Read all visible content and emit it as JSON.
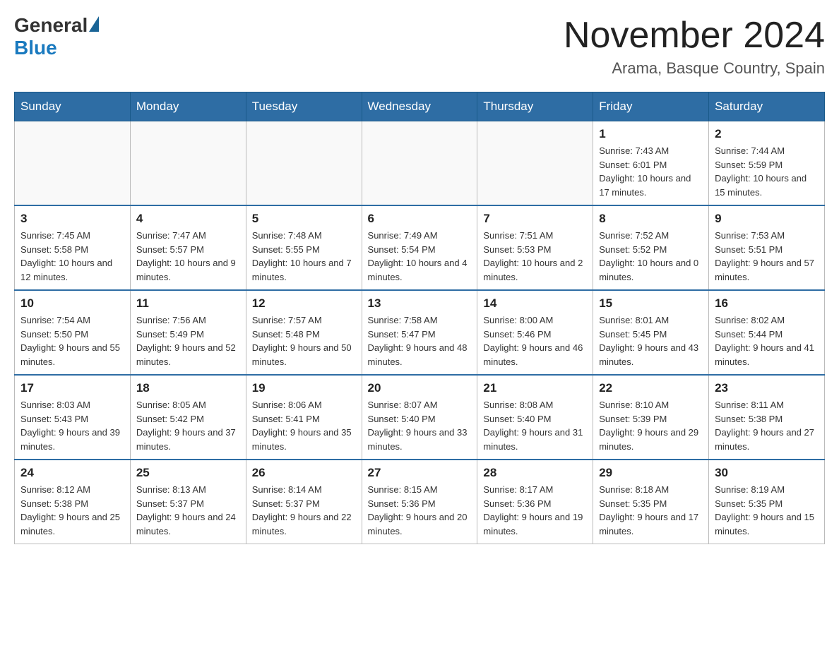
{
  "header": {
    "logo_general": "General",
    "logo_blue": "Blue",
    "month_title": "November 2024",
    "location": "Arama, Basque Country, Spain"
  },
  "days_of_week": [
    "Sunday",
    "Monday",
    "Tuesday",
    "Wednesday",
    "Thursday",
    "Friday",
    "Saturday"
  ],
  "weeks": [
    [
      {
        "day": "",
        "sunrise": "",
        "sunset": "",
        "daylight": ""
      },
      {
        "day": "",
        "sunrise": "",
        "sunset": "",
        "daylight": ""
      },
      {
        "day": "",
        "sunrise": "",
        "sunset": "",
        "daylight": ""
      },
      {
        "day": "",
        "sunrise": "",
        "sunset": "",
        "daylight": ""
      },
      {
        "day": "",
        "sunrise": "",
        "sunset": "",
        "daylight": ""
      },
      {
        "day": "1",
        "sunrise": "Sunrise: 7:43 AM",
        "sunset": "Sunset: 6:01 PM",
        "daylight": "Daylight: 10 hours and 17 minutes."
      },
      {
        "day": "2",
        "sunrise": "Sunrise: 7:44 AM",
        "sunset": "Sunset: 5:59 PM",
        "daylight": "Daylight: 10 hours and 15 minutes."
      }
    ],
    [
      {
        "day": "3",
        "sunrise": "Sunrise: 7:45 AM",
        "sunset": "Sunset: 5:58 PM",
        "daylight": "Daylight: 10 hours and 12 minutes."
      },
      {
        "day": "4",
        "sunrise": "Sunrise: 7:47 AM",
        "sunset": "Sunset: 5:57 PM",
        "daylight": "Daylight: 10 hours and 9 minutes."
      },
      {
        "day": "5",
        "sunrise": "Sunrise: 7:48 AM",
        "sunset": "Sunset: 5:55 PM",
        "daylight": "Daylight: 10 hours and 7 minutes."
      },
      {
        "day": "6",
        "sunrise": "Sunrise: 7:49 AM",
        "sunset": "Sunset: 5:54 PM",
        "daylight": "Daylight: 10 hours and 4 minutes."
      },
      {
        "day": "7",
        "sunrise": "Sunrise: 7:51 AM",
        "sunset": "Sunset: 5:53 PM",
        "daylight": "Daylight: 10 hours and 2 minutes."
      },
      {
        "day": "8",
        "sunrise": "Sunrise: 7:52 AM",
        "sunset": "Sunset: 5:52 PM",
        "daylight": "Daylight: 10 hours and 0 minutes."
      },
      {
        "day": "9",
        "sunrise": "Sunrise: 7:53 AM",
        "sunset": "Sunset: 5:51 PM",
        "daylight": "Daylight: 9 hours and 57 minutes."
      }
    ],
    [
      {
        "day": "10",
        "sunrise": "Sunrise: 7:54 AM",
        "sunset": "Sunset: 5:50 PM",
        "daylight": "Daylight: 9 hours and 55 minutes."
      },
      {
        "day": "11",
        "sunrise": "Sunrise: 7:56 AM",
        "sunset": "Sunset: 5:49 PM",
        "daylight": "Daylight: 9 hours and 52 minutes."
      },
      {
        "day": "12",
        "sunrise": "Sunrise: 7:57 AM",
        "sunset": "Sunset: 5:48 PM",
        "daylight": "Daylight: 9 hours and 50 minutes."
      },
      {
        "day": "13",
        "sunrise": "Sunrise: 7:58 AM",
        "sunset": "Sunset: 5:47 PM",
        "daylight": "Daylight: 9 hours and 48 minutes."
      },
      {
        "day": "14",
        "sunrise": "Sunrise: 8:00 AM",
        "sunset": "Sunset: 5:46 PM",
        "daylight": "Daylight: 9 hours and 46 minutes."
      },
      {
        "day": "15",
        "sunrise": "Sunrise: 8:01 AM",
        "sunset": "Sunset: 5:45 PM",
        "daylight": "Daylight: 9 hours and 43 minutes."
      },
      {
        "day": "16",
        "sunrise": "Sunrise: 8:02 AM",
        "sunset": "Sunset: 5:44 PM",
        "daylight": "Daylight: 9 hours and 41 minutes."
      }
    ],
    [
      {
        "day": "17",
        "sunrise": "Sunrise: 8:03 AM",
        "sunset": "Sunset: 5:43 PM",
        "daylight": "Daylight: 9 hours and 39 minutes."
      },
      {
        "day": "18",
        "sunrise": "Sunrise: 8:05 AM",
        "sunset": "Sunset: 5:42 PM",
        "daylight": "Daylight: 9 hours and 37 minutes."
      },
      {
        "day": "19",
        "sunrise": "Sunrise: 8:06 AM",
        "sunset": "Sunset: 5:41 PM",
        "daylight": "Daylight: 9 hours and 35 minutes."
      },
      {
        "day": "20",
        "sunrise": "Sunrise: 8:07 AM",
        "sunset": "Sunset: 5:40 PM",
        "daylight": "Daylight: 9 hours and 33 minutes."
      },
      {
        "day": "21",
        "sunrise": "Sunrise: 8:08 AM",
        "sunset": "Sunset: 5:40 PM",
        "daylight": "Daylight: 9 hours and 31 minutes."
      },
      {
        "day": "22",
        "sunrise": "Sunrise: 8:10 AM",
        "sunset": "Sunset: 5:39 PM",
        "daylight": "Daylight: 9 hours and 29 minutes."
      },
      {
        "day": "23",
        "sunrise": "Sunrise: 8:11 AM",
        "sunset": "Sunset: 5:38 PM",
        "daylight": "Daylight: 9 hours and 27 minutes."
      }
    ],
    [
      {
        "day": "24",
        "sunrise": "Sunrise: 8:12 AM",
        "sunset": "Sunset: 5:38 PM",
        "daylight": "Daylight: 9 hours and 25 minutes."
      },
      {
        "day": "25",
        "sunrise": "Sunrise: 8:13 AM",
        "sunset": "Sunset: 5:37 PM",
        "daylight": "Daylight: 9 hours and 24 minutes."
      },
      {
        "day": "26",
        "sunrise": "Sunrise: 8:14 AM",
        "sunset": "Sunset: 5:37 PM",
        "daylight": "Daylight: 9 hours and 22 minutes."
      },
      {
        "day": "27",
        "sunrise": "Sunrise: 8:15 AM",
        "sunset": "Sunset: 5:36 PM",
        "daylight": "Daylight: 9 hours and 20 minutes."
      },
      {
        "day": "28",
        "sunrise": "Sunrise: 8:17 AM",
        "sunset": "Sunset: 5:36 PM",
        "daylight": "Daylight: 9 hours and 19 minutes."
      },
      {
        "day": "29",
        "sunrise": "Sunrise: 8:18 AM",
        "sunset": "Sunset: 5:35 PM",
        "daylight": "Daylight: 9 hours and 17 minutes."
      },
      {
        "day": "30",
        "sunrise": "Sunrise: 8:19 AM",
        "sunset": "Sunset: 5:35 PM",
        "daylight": "Daylight: 9 hours and 15 minutes."
      }
    ]
  ]
}
